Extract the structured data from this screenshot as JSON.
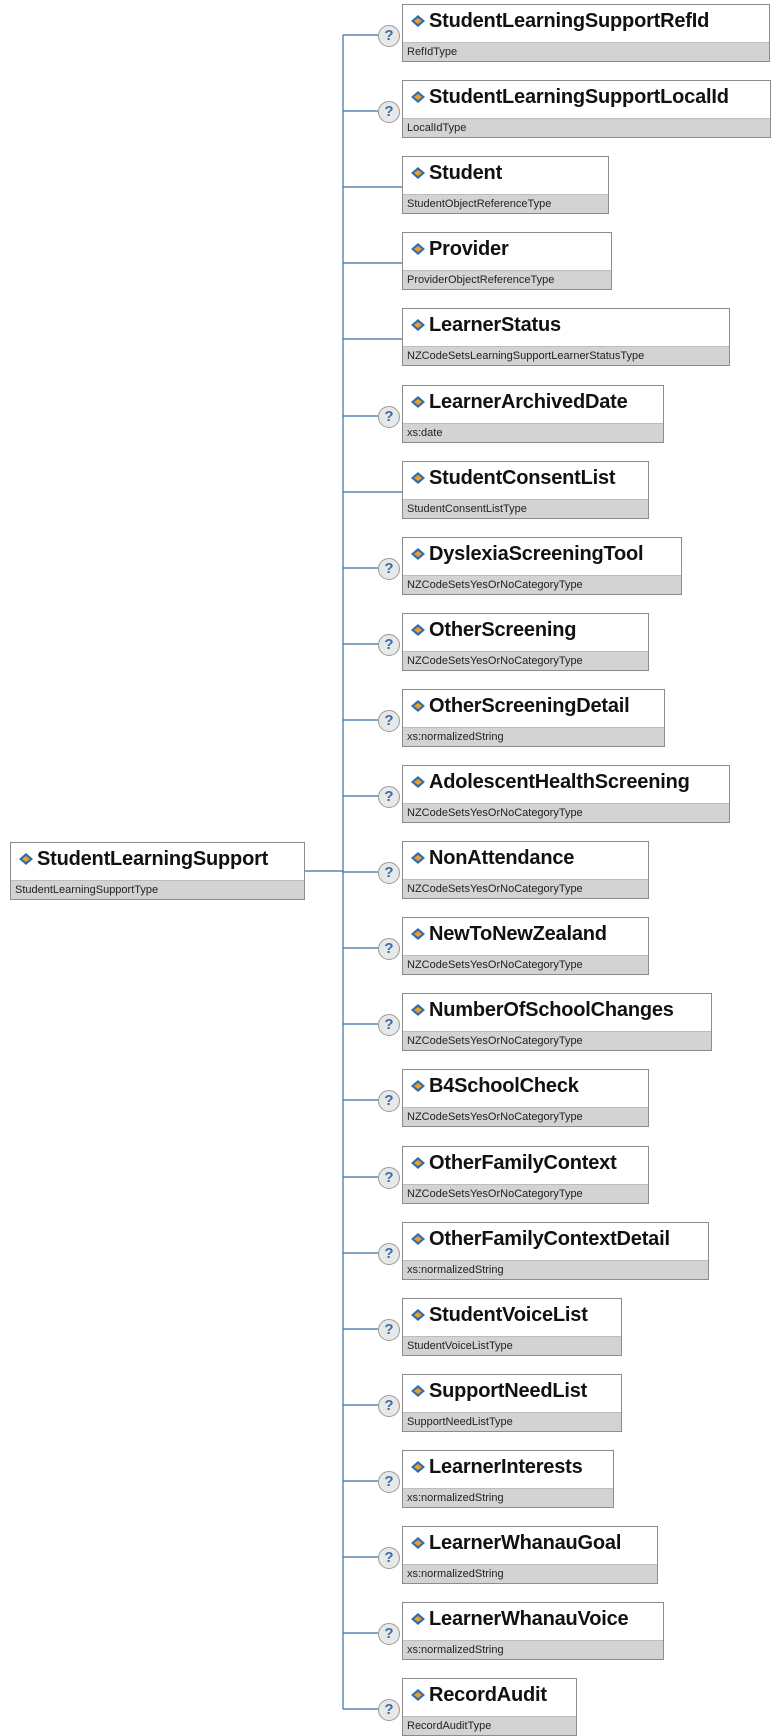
{
  "root": {
    "name": "StudentLearningSupport",
    "type": "StudentLearningSupportType"
  },
  "children": [
    {
      "name": "StudentLearningSupportRefId",
      "type": "RefIdType",
      "optional": true
    },
    {
      "name": "StudentLearningSupportLocalId",
      "type": "LocalIdType",
      "optional": true
    },
    {
      "name": "Student",
      "type": "StudentObjectReferenceType",
      "optional": false
    },
    {
      "name": "Provider",
      "type": "ProviderObjectReferenceType",
      "optional": false
    },
    {
      "name": "LearnerStatus",
      "type": "NZCodeSetsLearningSupportLearnerStatusType",
      "optional": false
    },
    {
      "name": "LearnerArchivedDate",
      "type": "xs:date",
      "optional": true
    },
    {
      "name": "StudentConsentList",
      "type": "StudentConsentListType",
      "optional": false
    },
    {
      "name": "DyslexiaScreeningTool",
      "type": "NZCodeSetsYesOrNoCategoryType",
      "optional": true
    },
    {
      "name": "OtherScreening",
      "type": "NZCodeSetsYesOrNoCategoryType",
      "optional": true
    },
    {
      "name": "OtherScreeningDetail",
      "type": "xs:normalizedString",
      "optional": true
    },
    {
      "name": "AdolescentHealthScreening",
      "type": "NZCodeSetsYesOrNoCategoryType",
      "optional": true
    },
    {
      "name": "NonAttendance",
      "type": "NZCodeSetsYesOrNoCategoryType",
      "optional": true
    },
    {
      "name": "NewToNewZealand",
      "type": "NZCodeSetsYesOrNoCategoryType",
      "optional": true
    },
    {
      "name": "NumberOfSchoolChanges",
      "type": "NZCodeSetsYesOrNoCategoryType",
      "optional": true
    },
    {
      "name": "B4SchoolCheck",
      "type": "NZCodeSetsYesOrNoCategoryType",
      "optional": true
    },
    {
      "name": "OtherFamilyContext",
      "type": "NZCodeSetsYesOrNoCategoryType",
      "optional": true
    },
    {
      "name": "OtherFamilyContextDetail",
      "type": "xs:normalizedString",
      "optional": true
    },
    {
      "name": "StudentVoiceList",
      "type": "StudentVoiceListType",
      "optional": true
    },
    {
      "name": "SupportNeedList",
      "type": "SupportNeedListType",
      "optional": true
    },
    {
      "name": "LearnerInterests",
      "type": "xs:normalizedString",
      "optional": true
    },
    {
      "name": "LearnerWhanauGoal",
      "type": "xs:normalizedString",
      "optional": true
    },
    {
      "name": "LearnerWhanauVoice",
      "type": "xs:normalizedString",
      "optional": true
    },
    {
      "name": "RecordAudit",
      "type": "RecordAuditType",
      "optional": true
    }
  ],
  "help_glyph": "?",
  "icons": {
    "element": "element-diamond-icon",
    "optional": "help-question-icon"
  },
  "colors": {
    "connector": "#3a6ea5",
    "icon_blue": "#2f6db3",
    "icon_orange": "#f0a020",
    "type_bar": "#d3d3d3"
  }
}
